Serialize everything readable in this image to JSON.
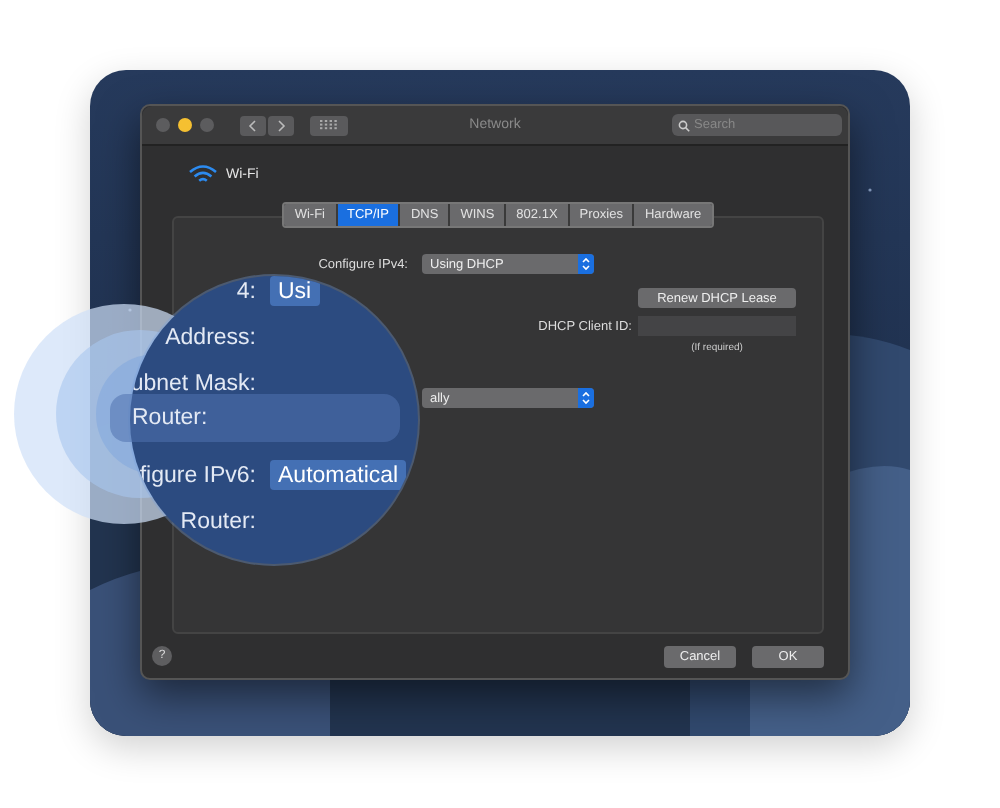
{
  "window": {
    "title": "Network",
    "search": {
      "placeholder": "Search"
    }
  },
  "interface": {
    "name": "Wi-Fi"
  },
  "tabs": [
    {
      "label": "Wi-Fi",
      "selected": false
    },
    {
      "label": "TCP/IP",
      "selected": true
    },
    {
      "label": "DNS",
      "selected": false
    },
    {
      "label": "WINS",
      "selected": false
    },
    {
      "label": "802.1X",
      "selected": false
    },
    {
      "label": "Proxies",
      "selected": false
    },
    {
      "label": "Hardware",
      "selected": false
    }
  ],
  "ipv4": {
    "label": "Configure IPv4:",
    "value": "Using DHCP"
  },
  "renew_button": "Renew DHCP Lease",
  "client_id": {
    "label": "DHCP Client ID:",
    "hint": "(If required)"
  },
  "ipv6_popup": {
    "value": "ally"
  },
  "magnifier": {
    "rows": [
      {
        "kind": "popup",
        "label": "4:",
        "value": "Usi"
      },
      {
        "kind": "label",
        "label": "Address:"
      },
      {
        "kind": "label",
        "label": "ubnet Mask:"
      },
      {
        "kind": "highlight",
        "label": "Router:"
      },
      {
        "kind": "popup",
        "label": "figure IPv6:",
        "value": "Automatical"
      },
      {
        "kind": "label",
        "label": "Router:"
      }
    ]
  },
  "buttons": {
    "help": "?",
    "cancel": "Cancel",
    "ok": "OK"
  }
}
